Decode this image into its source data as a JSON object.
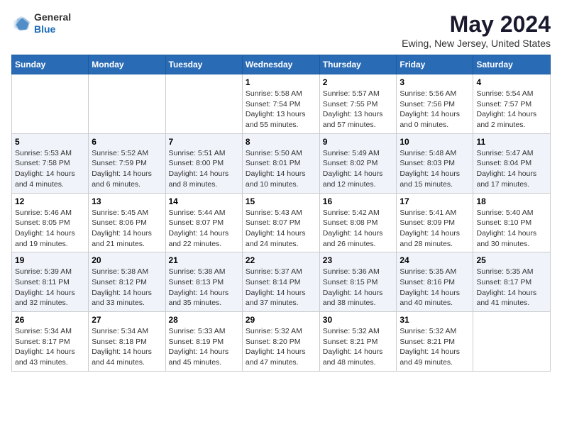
{
  "logo": {
    "general": "General",
    "blue": "Blue"
  },
  "title": "May 2024",
  "location": "Ewing, New Jersey, United States",
  "days_header": [
    "Sunday",
    "Monday",
    "Tuesday",
    "Wednesday",
    "Thursday",
    "Friday",
    "Saturday"
  ],
  "weeks": [
    [
      {
        "day": "",
        "info": ""
      },
      {
        "day": "",
        "info": ""
      },
      {
        "day": "",
        "info": ""
      },
      {
        "day": "1",
        "info": "Sunrise: 5:58 AM\nSunset: 7:54 PM\nDaylight: 13 hours\nand 55 minutes."
      },
      {
        "day": "2",
        "info": "Sunrise: 5:57 AM\nSunset: 7:55 PM\nDaylight: 13 hours\nand 57 minutes."
      },
      {
        "day": "3",
        "info": "Sunrise: 5:56 AM\nSunset: 7:56 PM\nDaylight: 14 hours\nand 0 minutes."
      },
      {
        "day": "4",
        "info": "Sunrise: 5:54 AM\nSunset: 7:57 PM\nDaylight: 14 hours\nand 2 minutes."
      }
    ],
    [
      {
        "day": "5",
        "info": "Sunrise: 5:53 AM\nSunset: 7:58 PM\nDaylight: 14 hours\nand 4 minutes."
      },
      {
        "day": "6",
        "info": "Sunrise: 5:52 AM\nSunset: 7:59 PM\nDaylight: 14 hours\nand 6 minutes."
      },
      {
        "day": "7",
        "info": "Sunrise: 5:51 AM\nSunset: 8:00 PM\nDaylight: 14 hours\nand 8 minutes."
      },
      {
        "day": "8",
        "info": "Sunrise: 5:50 AM\nSunset: 8:01 PM\nDaylight: 14 hours\nand 10 minutes."
      },
      {
        "day": "9",
        "info": "Sunrise: 5:49 AM\nSunset: 8:02 PM\nDaylight: 14 hours\nand 12 minutes."
      },
      {
        "day": "10",
        "info": "Sunrise: 5:48 AM\nSunset: 8:03 PM\nDaylight: 14 hours\nand 15 minutes."
      },
      {
        "day": "11",
        "info": "Sunrise: 5:47 AM\nSunset: 8:04 PM\nDaylight: 14 hours\nand 17 minutes."
      }
    ],
    [
      {
        "day": "12",
        "info": "Sunrise: 5:46 AM\nSunset: 8:05 PM\nDaylight: 14 hours\nand 19 minutes."
      },
      {
        "day": "13",
        "info": "Sunrise: 5:45 AM\nSunset: 8:06 PM\nDaylight: 14 hours\nand 21 minutes."
      },
      {
        "day": "14",
        "info": "Sunrise: 5:44 AM\nSunset: 8:07 PM\nDaylight: 14 hours\nand 22 minutes."
      },
      {
        "day": "15",
        "info": "Sunrise: 5:43 AM\nSunset: 8:07 PM\nDaylight: 14 hours\nand 24 minutes."
      },
      {
        "day": "16",
        "info": "Sunrise: 5:42 AM\nSunset: 8:08 PM\nDaylight: 14 hours\nand 26 minutes."
      },
      {
        "day": "17",
        "info": "Sunrise: 5:41 AM\nSunset: 8:09 PM\nDaylight: 14 hours\nand 28 minutes."
      },
      {
        "day": "18",
        "info": "Sunrise: 5:40 AM\nSunset: 8:10 PM\nDaylight: 14 hours\nand 30 minutes."
      }
    ],
    [
      {
        "day": "19",
        "info": "Sunrise: 5:39 AM\nSunset: 8:11 PM\nDaylight: 14 hours\nand 32 minutes."
      },
      {
        "day": "20",
        "info": "Sunrise: 5:38 AM\nSunset: 8:12 PM\nDaylight: 14 hours\nand 33 minutes."
      },
      {
        "day": "21",
        "info": "Sunrise: 5:38 AM\nSunset: 8:13 PM\nDaylight: 14 hours\nand 35 minutes."
      },
      {
        "day": "22",
        "info": "Sunrise: 5:37 AM\nSunset: 8:14 PM\nDaylight: 14 hours\nand 37 minutes."
      },
      {
        "day": "23",
        "info": "Sunrise: 5:36 AM\nSunset: 8:15 PM\nDaylight: 14 hours\nand 38 minutes."
      },
      {
        "day": "24",
        "info": "Sunrise: 5:35 AM\nSunset: 8:16 PM\nDaylight: 14 hours\nand 40 minutes."
      },
      {
        "day": "25",
        "info": "Sunrise: 5:35 AM\nSunset: 8:17 PM\nDaylight: 14 hours\nand 41 minutes."
      }
    ],
    [
      {
        "day": "26",
        "info": "Sunrise: 5:34 AM\nSunset: 8:17 PM\nDaylight: 14 hours\nand 43 minutes."
      },
      {
        "day": "27",
        "info": "Sunrise: 5:34 AM\nSunset: 8:18 PM\nDaylight: 14 hours\nand 44 minutes."
      },
      {
        "day": "28",
        "info": "Sunrise: 5:33 AM\nSunset: 8:19 PM\nDaylight: 14 hours\nand 45 minutes."
      },
      {
        "day": "29",
        "info": "Sunrise: 5:32 AM\nSunset: 8:20 PM\nDaylight: 14 hours\nand 47 minutes."
      },
      {
        "day": "30",
        "info": "Sunrise: 5:32 AM\nSunset: 8:21 PM\nDaylight: 14 hours\nand 48 minutes."
      },
      {
        "day": "31",
        "info": "Sunrise: 5:32 AM\nSunset: 8:21 PM\nDaylight: 14 hours\nand 49 minutes."
      },
      {
        "day": "",
        "info": ""
      }
    ]
  ]
}
